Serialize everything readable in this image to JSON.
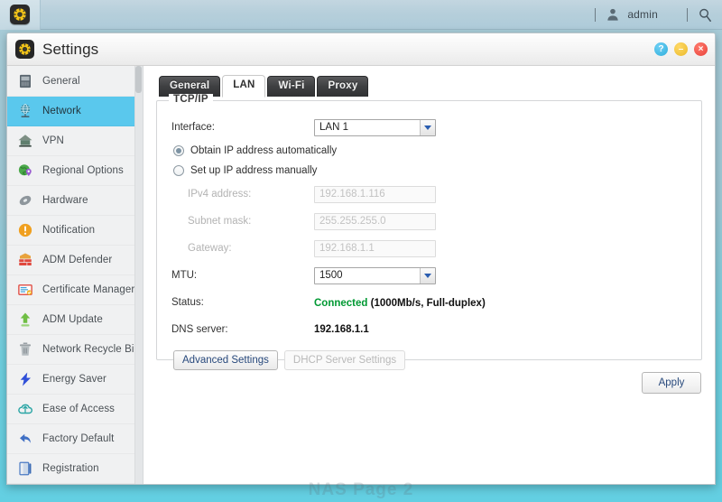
{
  "desktop": {
    "topbar": {
      "launcher_icon": "gear-app-icon",
      "user_icon": "user-icon",
      "user_name": "admin",
      "search_icon": "search-icon"
    },
    "watermark": "NAS Page 2"
  },
  "window": {
    "icon": "gear-app-icon",
    "title": "Settings",
    "controls": {
      "help_label": "?",
      "minimize_label": "–",
      "close_label": "×"
    }
  },
  "sidebar": {
    "items": [
      {
        "label": "General",
        "icon": "server-rack-icon",
        "active": false
      },
      {
        "label": "Network",
        "icon": "globe-network-icon",
        "active": true
      },
      {
        "label": "VPN",
        "icon": "house-shield-icon",
        "active": false
      },
      {
        "label": "Regional Options",
        "icon": "globe-pin-icon",
        "active": false
      },
      {
        "label": "Hardware",
        "icon": "hardware-disc-icon",
        "active": false
      },
      {
        "label": "Notification",
        "icon": "alert-circle-icon",
        "active": false
      },
      {
        "label": "ADM Defender",
        "icon": "firewall-brick-icon",
        "active": false
      },
      {
        "label": "Certificate Manager",
        "icon": "certificate-icon",
        "active": false
      },
      {
        "label": "ADM Update",
        "icon": "upload-arrow-icon",
        "active": false
      },
      {
        "label": "Network Recycle Bin",
        "icon": "trash-bin-icon",
        "active": false
      },
      {
        "label": "Energy Saver",
        "icon": "lightning-bolt-icon",
        "active": false
      },
      {
        "label": "Ease of Access",
        "icon": "cloud-arrow-icon",
        "active": false
      },
      {
        "label": "Factory Default",
        "icon": "undo-arrow-icon",
        "active": false
      },
      {
        "label": "Registration",
        "icon": "document-book-icon",
        "active": false
      }
    ]
  },
  "content": {
    "tabs": [
      {
        "label": "General",
        "active": false
      },
      {
        "label": "LAN",
        "active": true
      },
      {
        "label": "Wi-Fi",
        "active": false
      },
      {
        "label": "Proxy",
        "active": false
      }
    ],
    "panel": {
      "legend": "TCP/IP",
      "interface": {
        "label": "Interface:",
        "value": "LAN 1",
        "options": [
          "LAN 1"
        ]
      },
      "ip_mode": {
        "auto": {
          "label": "Obtain IP address automatically",
          "selected": true
        },
        "manual": {
          "label": "Set up IP address manually",
          "selected": false
        }
      },
      "ipv4": {
        "label": "IPv4 address:",
        "value": "192.168.1.116",
        "disabled": true
      },
      "subnet": {
        "label": "Subnet mask:",
        "value": "255.255.255.0",
        "disabled": true
      },
      "gateway": {
        "label": "Gateway:",
        "value": "192.168.1.1",
        "disabled": true
      },
      "mtu": {
        "label": "MTU:",
        "value": "1500",
        "options": [
          "1500"
        ]
      },
      "status": {
        "label": "Status:",
        "state": "Connected",
        "detail": " (1000Mb/s, Full-duplex)",
        "state_color": "#009933"
      },
      "dns": {
        "label": "DNS server:",
        "value": "192.168.1.1"
      },
      "buttons": {
        "advanced": {
          "label": "Advanced Settings",
          "disabled": false
        },
        "dhcp": {
          "label": "DHCP Server Settings",
          "disabled": true
        }
      }
    },
    "apply_label": "Apply"
  }
}
